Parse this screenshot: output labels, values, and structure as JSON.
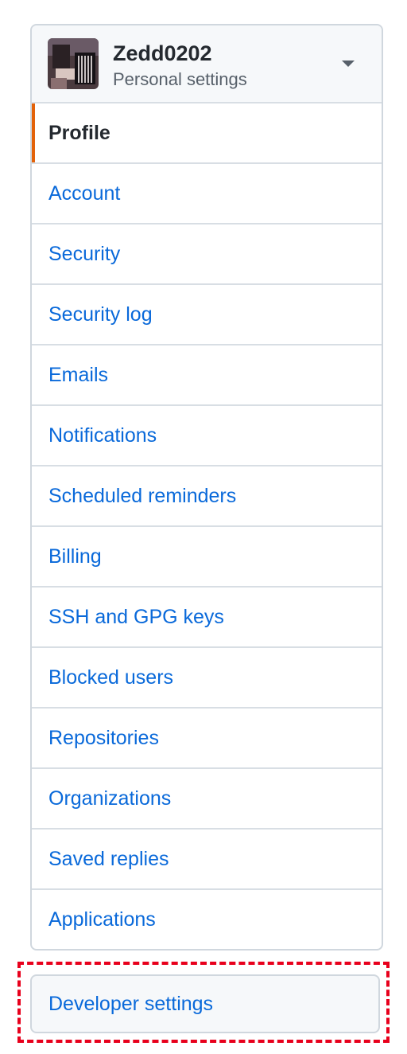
{
  "account": {
    "username": "Zedd0202",
    "subtitle": "Personal settings"
  },
  "nav": {
    "items": [
      {
        "label": "Profile",
        "selected": true
      },
      {
        "label": "Account"
      },
      {
        "label": "Security"
      },
      {
        "label": "Security log"
      },
      {
        "label": "Emails"
      },
      {
        "label": "Notifications"
      },
      {
        "label": "Scheduled reminders"
      },
      {
        "label": "Billing"
      },
      {
        "label": "SSH and GPG keys"
      },
      {
        "label": "Blocked users"
      },
      {
        "label": "Repositories"
      },
      {
        "label": "Organizations"
      },
      {
        "label": "Saved replies"
      },
      {
        "label": "Applications"
      }
    ]
  },
  "developer": {
    "label": "Developer settings"
  },
  "colors": {
    "link": "#0969da",
    "selected_marker": "#e36209",
    "highlight_border": "#e8001c"
  },
  "icons": {
    "dropdown": "caret-down-icon"
  }
}
